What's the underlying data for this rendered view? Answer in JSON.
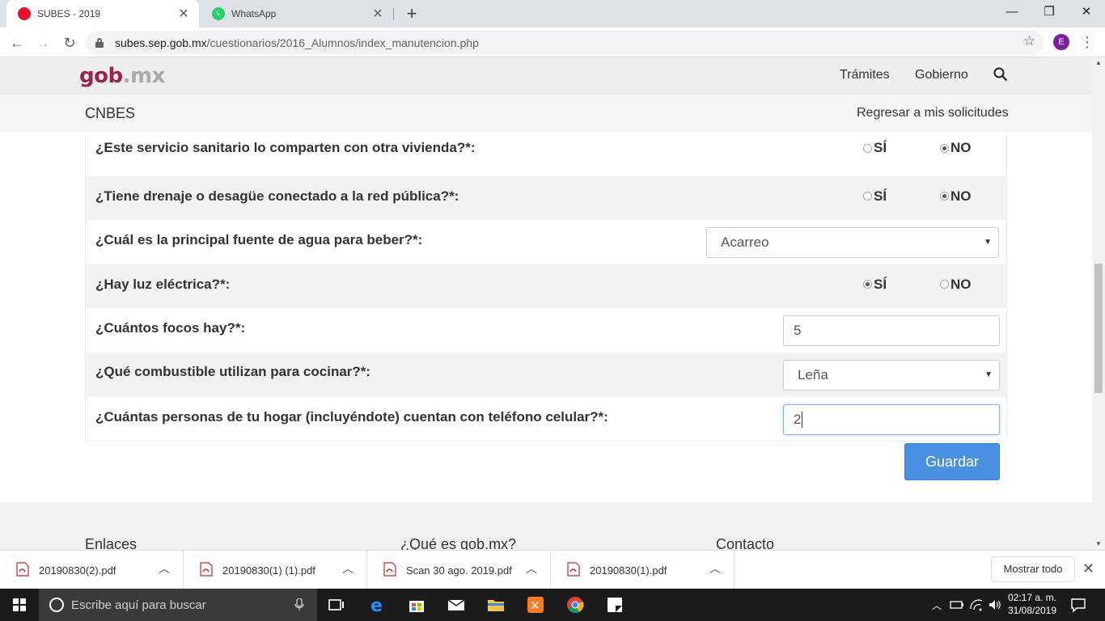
{
  "browser": {
    "tabs": [
      {
        "title": "SUBES - 2019",
        "active": true
      },
      {
        "title": "WhatsApp",
        "active": false
      }
    ],
    "url_host": "subes.sep.gob.mx",
    "url_path": "/cuestionarios/2016_Alumnos/index_manutencion.php",
    "profile_initial": "E"
  },
  "header": {
    "logo_gob": "gob",
    "logo_mx": ".mx",
    "nav": [
      "Trámites",
      "Gobierno"
    ]
  },
  "subheader": {
    "title": "CNBES",
    "back_link": "Regresar a mis solicitudes"
  },
  "form": {
    "yes_label": "SÍ",
    "no_label": "NO",
    "questions": [
      {
        "text": "¿Este servicio sanitario lo comparten con otra vivienda?*:",
        "type": "radio",
        "selected": "NO"
      },
      {
        "text": "¿Tiene drenaje o desagüe conectado a la red pública?*:",
        "type": "radio",
        "selected": "NO"
      },
      {
        "text": "¿Cuál es la principal fuente de agua para beber?*:",
        "type": "select",
        "value": "Acarreo"
      },
      {
        "text": "¿Hay luz eléctrica?*:",
        "type": "radio",
        "selected": "SÍ"
      },
      {
        "text": "¿Cuántos focos hay?*:",
        "type": "input",
        "value": "5"
      },
      {
        "text": "¿Qué combustible utilizan para cocinar?*:",
        "type": "select",
        "value": "Leña"
      },
      {
        "text": "¿Cuántas personas de tu hogar (incluyéndote) cuentan con teléfono celular?*:",
        "type": "input",
        "value": "2"
      }
    ],
    "save_label": "Guardar"
  },
  "footer": {
    "columns": [
      "Enlaces",
      "¿Qué es gob.mx?",
      "Contacto"
    ]
  },
  "downloads": {
    "items": [
      "20190830(2).pdf",
      "20190830(1) (1).pdf",
      "Scan 30 ago. 2019.pdf",
      "20190830(1).pdf"
    ],
    "show_all": "Mostrar todo"
  },
  "taskbar": {
    "search_placeholder": "Escribe aquí para buscar",
    "time": "02:17 a. m.",
    "date": "31/08/2019"
  },
  "colors": {
    "gob_red": "#9d2449",
    "button_blue": "#4a90e2"
  }
}
